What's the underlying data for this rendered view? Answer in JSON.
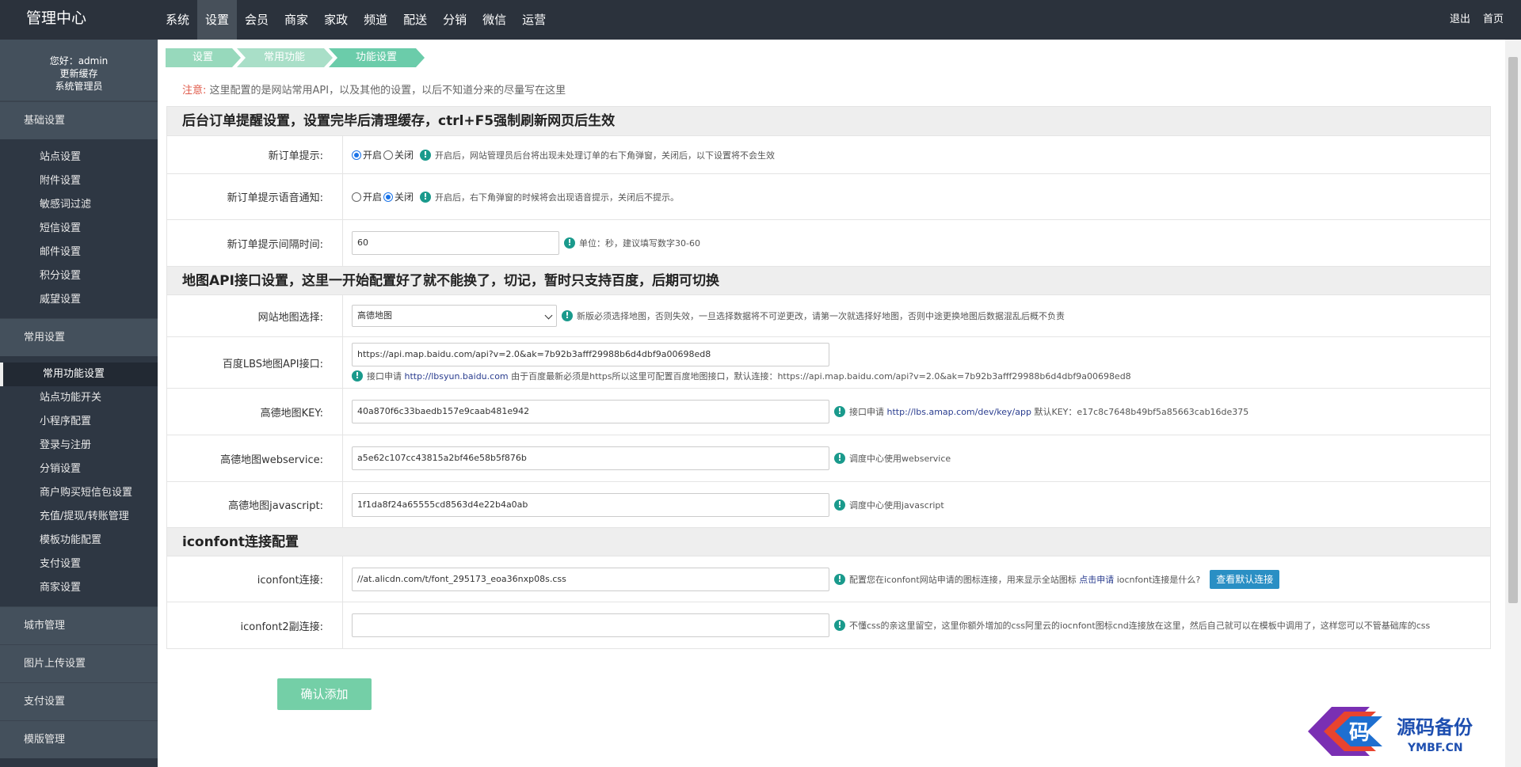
{
  "header": {
    "brand": "管理中心",
    "nav": [
      "系统",
      "设置",
      "会员",
      "商家",
      "家政",
      "频道",
      "配送",
      "分销",
      "微信",
      "运营"
    ],
    "active_nav": "设置",
    "right_links": [
      "退出",
      "首页"
    ]
  },
  "sidebar": {
    "greeting": "您好：admin",
    "refresh_cache": "更新缓存",
    "role": "系统管理员",
    "groups": [
      {
        "label": "基础设置",
        "items": [
          "站点设置",
          "附件设置",
          "敏感词过滤",
          "短信设置",
          "邮件设置",
          "积分设置",
          "威望设置"
        ]
      },
      {
        "label": "常用设置",
        "items": [
          "常用功能设置",
          "站点功能开关",
          "小程序配置",
          "登录与注册",
          "分销设置",
          "商户购买短信包设置",
          "充值/提现/转账管理",
          "模板功能配置",
          "支付设置",
          "商家设置"
        ]
      },
      {
        "label": "城市管理",
        "items": []
      },
      {
        "label": "图片上传设置",
        "items": []
      },
      {
        "label": "支付设置",
        "items": []
      },
      {
        "label": "模版管理",
        "items": []
      }
    ],
    "active_item": "常用功能设置"
  },
  "breadcrumb": [
    "设置",
    "常用功能",
    "功能设置"
  ],
  "notice": {
    "label": "注意:",
    "text": "这里配置的是网站常用API，以及其他的设置，以后不知道分来的尽量写在这里"
  },
  "sections": {
    "order": {
      "title": "后台订单提醒设置，设置完毕后清理缓存，ctrl+F5强制刷新网页后生效",
      "new_order_label": "新订单提示:",
      "new_order_on": "开启",
      "new_order_off": "关闭",
      "new_order_hint": "开启后，网站管理员后台将出现未处理订单的右下角弹窗，关闭后，以下设置将不会生效",
      "voice_label": "新订单提示语音通知:",
      "voice_on": "开启",
      "voice_off": "关闭",
      "voice_hint": "开启后，右下角弹窗的时候将会出现语音提示，关闭后不提示。",
      "interval_label": "新订单提示间隔时间:",
      "interval_value": "60",
      "interval_hint": "单位：秒，建议填写数字30-60"
    },
    "map": {
      "title": "地图API接口设置，这里一开始配置好了就不能换了，切记，暂时只支持百度，后期可切换",
      "select_label": "网站地图选择:",
      "select_value": "高德地图",
      "select_hint": "新版必须选择地图，否则失效，一旦选择数据将不可逆更改，请第一次就选择好地图，否则中途更换地图后数据混乱后概不负责",
      "baidu_label": "百度LBS地图API接口:",
      "baidu_value": "https://api.map.baidu.com/api?v=2.0&ak=7b92b3afff29988b6d4dbf9a00698ed8",
      "baidu_hint_prefix": "接口申请",
      "baidu_hint_link": "http://lbsyun.baidu.com",
      "baidu_hint_suffix": "由于百度最新必须是https所以这里可配置百度地图接口，默认连接：https://api.map.baidu.com/api?v=2.0&ak=7b92b3afff29988b6d4dbf9a00698ed8",
      "amap_key_label": "高德地图KEY:",
      "amap_key_value": "40a870f6c33baedb157e9caab481e942",
      "amap_key_hint_prefix": "接口申请",
      "amap_key_hint_link": "http://lbs.amap.com/dev/key/app",
      "amap_key_hint_suffix": "默认KEY：e17c8c7648b49bf5a85663cab16de375",
      "amap_ws_label": "高德地图webservice:",
      "amap_ws_value": "a5e62c107cc43815a2bf46e58b5f876b",
      "amap_ws_hint": "调度中心使用webservice",
      "amap_js_label": "高德地图javascript:",
      "amap_js_value": "1f1da8f24a65555cd8563d4e22b4a0ab",
      "amap_js_hint": "调度中心使用javascript"
    },
    "iconfont": {
      "title": "iconfont连接配置",
      "link_label": "iconfont连接:",
      "link_value": "//at.alicdn.com/t/font_295173_eoa36nxp08s.css",
      "link_hint_prefix": "配置您在iconfont网站申请的图标连接，用来显示全站图标",
      "link_hint_link": "点击申请",
      "link_hint_suffix": "iocnfont连接是什么?",
      "link_button": "查看默认连接",
      "link2_label": "iconfont2副连接:",
      "link2_value": "",
      "link2_hint": "不懂css的亲这里留空，这里你额外增加的css阿里云的iocnfont图标cnd连接放在这里，然后自己就可以在模板中调用了，这样您可以不管基础库的css"
    }
  },
  "submit_label": "确认添加",
  "watermark": {
    "glyph": "码",
    "title": "源码备份",
    "domain": "YMBF.CN"
  }
}
